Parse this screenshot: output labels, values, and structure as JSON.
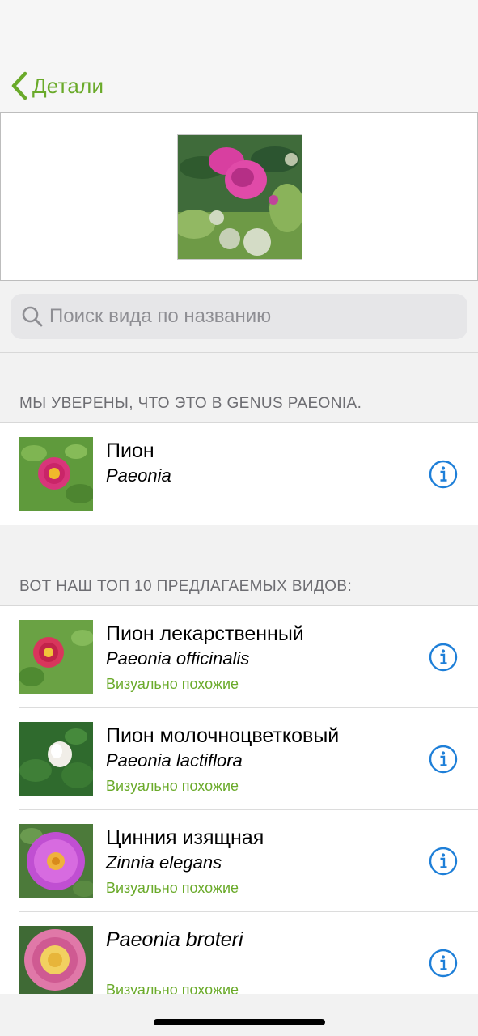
{
  "nav": {
    "back_label": "Детали",
    "accent_color": "#6aaa2a"
  },
  "search": {
    "placeholder": "Поиск вида по названию"
  },
  "genus_section": {
    "header": "МЫ УВЕРЕНЫ, ЧТО ЭТО В GENUS PAEONIA.",
    "items": [
      {
        "title": "Пион",
        "latin": "Paeonia"
      }
    ]
  },
  "top_section": {
    "header": "ВОТ НАШ ТОП 10 ПРЕДЛАГАЕМЫХ ВИДОВ:",
    "items": [
      {
        "title": "Пион лекарственный",
        "latin": "Paeonia officinalis",
        "tag": "Визуально похожие"
      },
      {
        "title": "Пион молочноцветковый",
        "latin": "Paeonia lactiflora",
        "tag": "Визуально похожие"
      },
      {
        "title": "Цинния изящная",
        "latin": "Zinnia elegans",
        "tag": "Визуально похожие"
      },
      {
        "title": "",
        "latin": "Paeonia broteri",
        "tag": "Визуально похожие"
      }
    ]
  },
  "icons": {
    "back": "chevron-left-icon",
    "search": "magnifier-icon",
    "info": "info-circle-icon"
  }
}
